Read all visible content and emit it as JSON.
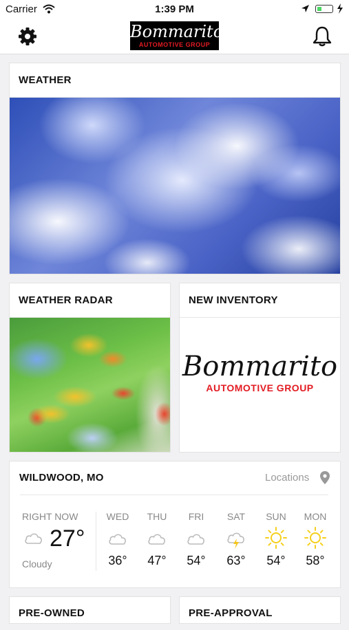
{
  "status_bar": {
    "carrier": "Carrier",
    "time": "1:39 PM"
  },
  "app_bar": {
    "logo_script": "Bommarito",
    "logo_sub": "AUTOMOTIVE GROUP"
  },
  "weather_card": {
    "title": "WEATHER"
  },
  "radar_card": {
    "title": "WEATHER RADAR"
  },
  "inventory_card": {
    "title": "NEW INVENTORY",
    "logo_script": "Bommarito",
    "logo_sub": "AUTOMOTIVE GROUP"
  },
  "forecast": {
    "location": "WILDWOOD, MO",
    "locations_link": "Locations",
    "now": {
      "label": "RIGHT NOW",
      "temp": "27°",
      "condition": "Cloudy",
      "icon": "cloud-icon"
    },
    "days": [
      {
        "day": "WED",
        "temp": "36°",
        "icon": "cloud-icon"
      },
      {
        "day": "THU",
        "temp": "47°",
        "icon": "cloud-icon"
      },
      {
        "day": "FRI",
        "temp": "54°",
        "icon": "cloud-icon"
      },
      {
        "day": "SAT",
        "temp": "63°",
        "icon": "thunderstorm-icon"
      },
      {
        "day": "SUN",
        "temp": "54°",
        "icon": "sun-icon"
      },
      {
        "day": "MON",
        "temp": "58°",
        "icon": "sun-icon"
      }
    ]
  },
  "bottom_cards": {
    "left": "PRE-OWNED",
    "right": "PRE-APPROVAL"
  },
  "colors": {
    "brand_red": "#e31b23",
    "sun_yellow": "#f5cf1b",
    "bolt_yellow": "#f5c518"
  }
}
